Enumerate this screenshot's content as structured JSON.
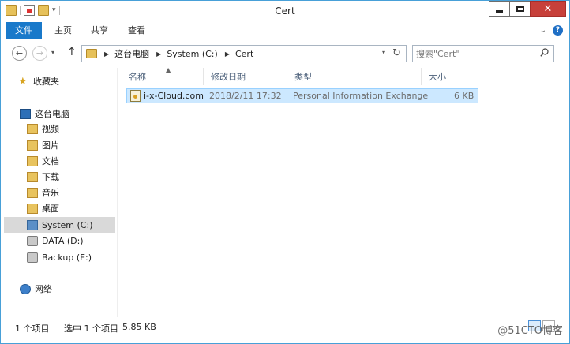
{
  "window": {
    "title": "Cert"
  },
  "ribbon": {
    "tabs": [
      {
        "label": "文件",
        "active": true
      },
      {
        "label": "主页"
      },
      {
        "label": "共享"
      },
      {
        "label": "查看"
      }
    ]
  },
  "nav": {
    "breadcrumb": [
      "这台电脑",
      "System (C:)",
      "Cert"
    ],
    "search_placeholder": "搜索\"Cert\""
  },
  "sidebar": {
    "favorites": "收藏夹",
    "this_pc": "这台电脑",
    "libraries": [
      "视频",
      "图片",
      "文档",
      "下载",
      "音乐",
      "桌面"
    ],
    "drives": [
      "System (C:)",
      "DATA (D:)",
      "Backup (E:)"
    ],
    "network": "网络",
    "selected": "System (C:)"
  },
  "columns": [
    "名称",
    "修改日期",
    "类型",
    "大小"
  ],
  "files": [
    {
      "name": "i-x-Cloud.com",
      "date": "2018/2/11 17:32",
      "type": "Personal Information Exchange",
      "size": "6 KB",
      "icon": "pfx-certificate-icon",
      "selected": true
    }
  ],
  "status": {
    "count": "1 个项目",
    "selected": "选中 1 个项目",
    "size": "5.85 KB",
    "watermark": "@51CTO博客"
  },
  "colors": {
    "accent": "#1979ca",
    "selection": "#cce8ff",
    "close": "#c7403a"
  }
}
